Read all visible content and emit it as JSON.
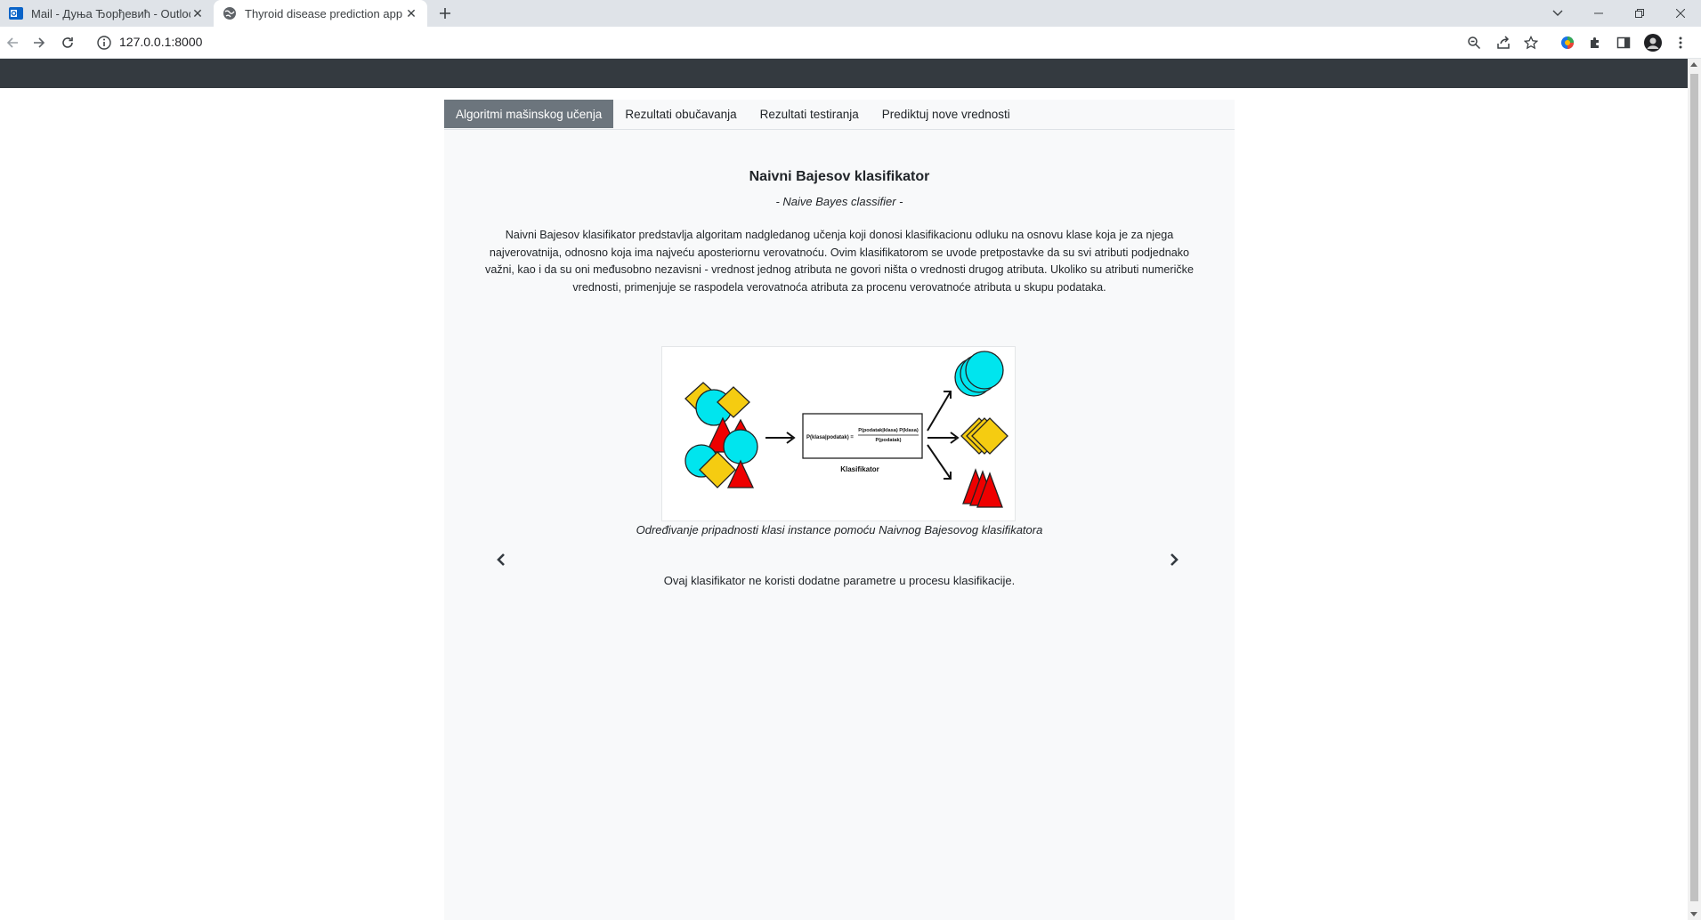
{
  "browser": {
    "tabs": [
      {
        "title": "Mail - Дуња Ђорђевић - Outlook",
        "active": false,
        "icon": "outlook-icon"
      },
      {
        "title": "Thyroid disease prediction app",
        "active": true,
        "icon": "globe-icon"
      }
    ],
    "url": "127.0.0.1:8000"
  },
  "colors": {
    "navbar": "#343a40",
    "active_tab": "#6c757d",
    "panel_background": "#f8f9fa",
    "cyan_shape": "#00e5ee",
    "yellow_shape": "#f5cc11",
    "red_shape": "#ee0000"
  },
  "nav": {
    "tabs": [
      {
        "label": "Algoritmi mašinskog učenja",
        "active": true
      },
      {
        "label": "Rezultati obučavanja",
        "active": false
      },
      {
        "label": "Rezultati testiranja",
        "active": false
      },
      {
        "label": "Prediktuj nove vrednosti",
        "active": false
      }
    ]
  },
  "slide": {
    "title": "Naivni Bajesov klasifikator",
    "subtitle": "- Naive Bayes classifier -",
    "description": "Naivni Bajesov klasifikator predstavlja algoritam nadgledanog učenja koji donosi klasifikacionu odluku na osnovu klase koja je za njega najverovatnija, odnosno koja ima najveću aposteriornu verovatnoću. Ovim klasifikatorom se uvode pretpostavke da su svi atributi podjednako važni, kao i da su oni međusobno nezavisni - vrednost jednog atributa ne govori ništa o vrednosti drugog atributa. Ukoliko su atributi numeričke vrednosti, primenjuje se raspodela verovatnoća atributa za procenu verovatnoće atributa u skupu podataka.",
    "figure": {
      "formula_left": "P(klasa|podatak) =",
      "formula_numerator": "P(podatak|klasa) P(klasa)",
      "formula_denominator": "P(podatak)",
      "box_label": "Klasifikator",
      "caption": "Određivanje pripadnosti klasi instance pomoću Naivnog Bajesovog klasifikatora"
    },
    "params_text": "Ovaj klasifikator ne koristi dodatne parametre u procesu klasifikacije."
  }
}
